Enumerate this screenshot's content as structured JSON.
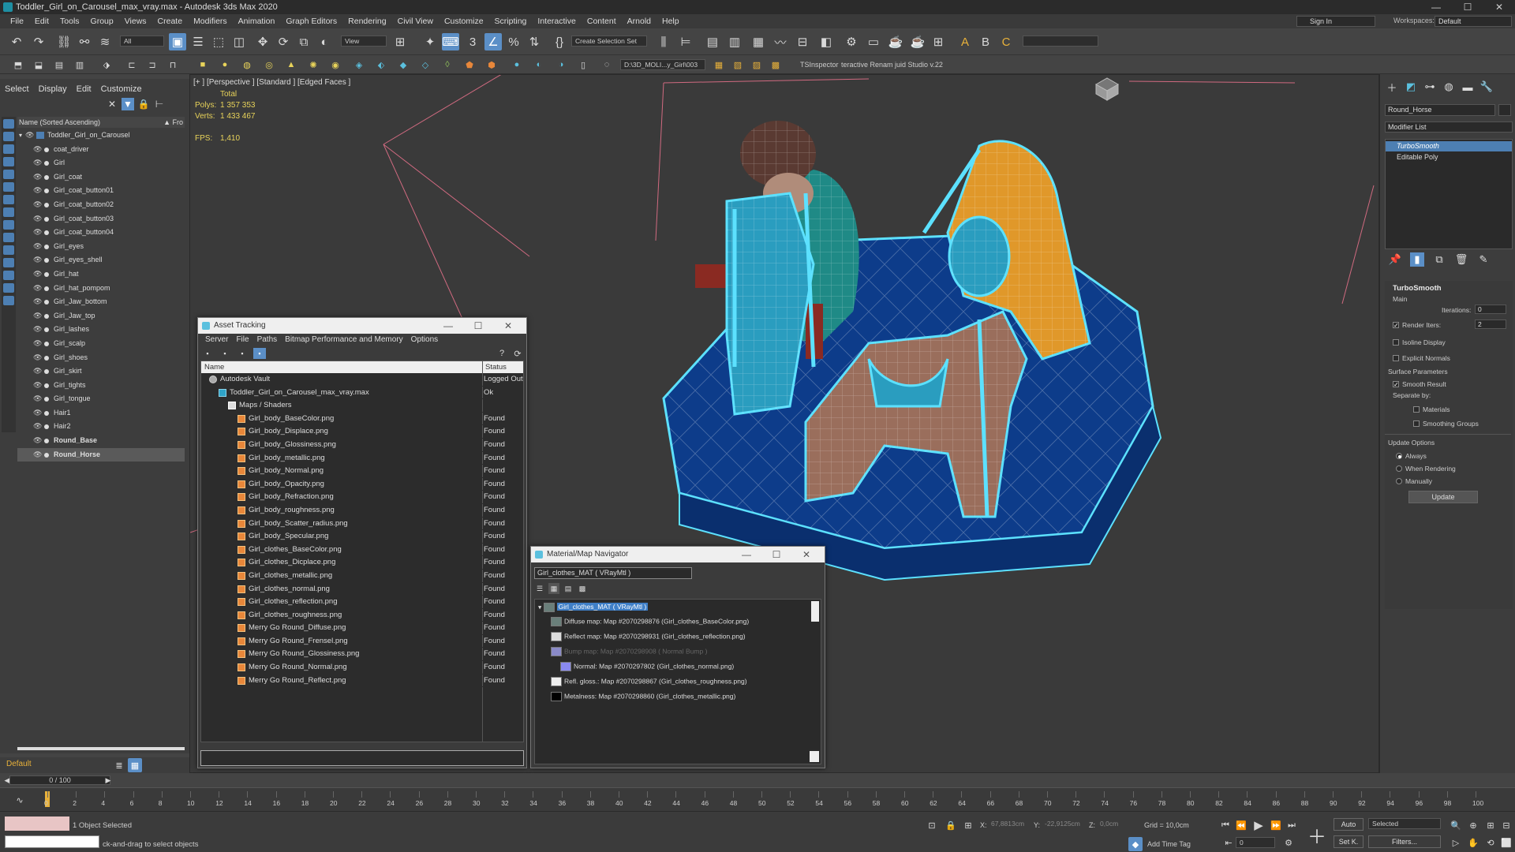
{
  "app": {
    "title": "Toddler_Girl_on_Carousel_max_vray.max - Autodesk 3ds Max 2020",
    "window_controls": [
      "—",
      "☐",
      "✕"
    ]
  },
  "menubar": {
    "items": [
      "File",
      "Edit",
      "Tools",
      "Group",
      "Views",
      "Create",
      "Modifiers",
      "Animation",
      "Graph Editors",
      "Rendering",
      "Civil View",
      "Customize",
      "Scripting",
      "Interactive",
      "Content",
      "Arnold",
      "Help"
    ],
    "sign_in": "Sign In",
    "workspaces_label": "Workspaces:",
    "workspaces_value": "Default"
  },
  "toolbar": {
    "selection_filter": "All",
    "ref_coord": "View",
    "named_selection": "Create Selection Set",
    "path": "D:\\3D_MOLI...y_Girl\\003",
    "ts_inspector": "TSInspector",
    "renamer": "teractive Renam juid Studio v.22"
  },
  "scene_explorer": {
    "tabs": [
      "Select",
      "Display",
      "Edit",
      "Customize"
    ],
    "column_header": "Name (Sorted Ascending)",
    "column_suffix": "▲ Fro",
    "root": "Toddler_Girl_on_Carousel",
    "items": [
      "coat_driver",
      "Girl",
      "Girl_coat",
      "Girl_coat_button01",
      "Girl_coat_button02",
      "Girl_coat_button03",
      "Girl_coat_button04",
      "Girl_eyes",
      "Girl_eyes_shell",
      "Girl_hat",
      "Girl_hat_pompom",
      "Girl_Jaw_bottom",
      "Girl_Jaw_top",
      "Girl_lashes",
      "Girl_scalp",
      "Girl_shoes",
      "Girl_skirt",
      "Girl_tights",
      "Girl_tongue",
      "Hair1",
      "Hair2",
      "Round_Base",
      "Round_Horse"
    ],
    "bold_items": [
      "Round_Base",
      "Round_Horse"
    ],
    "selected_item": "Round_Horse",
    "layer": "Default"
  },
  "viewport": {
    "label": "[+ ] [Perspective ] [Standard ] [Edged Faces ]",
    "stats_header": "Total",
    "polys_label": "Polys:",
    "polys_value": "1 357 353",
    "verts_label": "Verts:",
    "verts_value": "1 433 467",
    "fps_label": "FPS:",
    "fps_value": "1,410"
  },
  "asset_tracking": {
    "title": "Asset Tracking",
    "menu": [
      "Server",
      "File",
      "Paths",
      "Bitmap Performance and Memory",
      "Options"
    ],
    "col_name": "Name",
    "col_status": "Status",
    "rows": [
      {
        "name": "Autodesk Vault",
        "status": "Logged Out",
        "indent": 0,
        "kind": "vault"
      },
      {
        "name": "Toddler_Girl_on_Carousel_max_vray.max",
        "status": "Ok",
        "indent": 1,
        "kind": "file"
      },
      {
        "name": "Maps / Shaders",
        "status": "",
        "indent": 2,
        "kind": "folder"
      },
      {
        "name": "Girl_body_BaseColor.png",
        "status": "Found",
        "indent": 3,
        "kind": "map"
      },
      {
        "name": "Girl_body_Displace.png",
        "status": "Found",
        "indent": 3,
        "kind": "map"
      },
      {
        "name": "Girl_body_Glossiness.png",
        "status": "Found",
        "indent": 3,
        "kind": "map"
      },
      {
        "name": "Girl_body_metallic.png",
        "status": "Found",
        "indent": 3,
        "kind": "map"
      },
      {
        "name": "Girl_body_Normal.png",
        "status": "Found",
        "indent": 3,
        "kind": "map"
      },
      {
        "name": "Girl_body_Opacity.png",
        "status": "Found",
        "indent": 3,
        "kind": "map"
      },
      {
        "name": "Girl_body_Refraction.png",
        "status": "Found",
        "indent": 3,
        "kind": "map"
      },
      {
        "name": "Girl_body_roughness.png",
        "status": "Found",
        "indent": 3,
        "kind": "map"
      },
      {
        "name": "Girl_body_Scatter_radius.png",
        "status": "Found",
        "indent": 3,
        "kind": "map"
      },
      {
        "name": "Girl_body_Specular.png",
        "status": "Found",
        "indent": 3,
        "kind": "map"
      },
      {
        "name": "Girl_clothes_BaseColor.png",
        "status": "Found",
        "indent": 3,
        "kind": "map"
      },
      {
        "name": "Girl_clothes_Dicplace.png",
        "status": "Found",
        "indent": 3,
        "kind": "map"
      },
      {
        "name": "Girl_clothes_metallic.png",
        "status": "Found",
        "indent": 3,
        "kind": "map"
      },
      {
        "name": "Girl_clothes_normal.png",
        "status": "Found",
        "indent": 3,
        "kind": "map"
      },
      {
        "name": "Girl_clothes_reflection.png",
        "status": "Found",
        "indent": 3,
        "kind": "map"
      },
      {
        "name": "Girl_clothes_roughness.png",
        "status": "Found",
        "indent": 3,
        "kind": "map"
      },
      {
        "name": "Merry Go Round_Diffuse.png",
        "status": "Found",
        "indent": 3,
        "kind": "map"
      },
      {
        "name": "Merry Go Round_Frensel.png",
        "status": "Found",
        "indent": 3,
        "kind": "map"
      },
      {
        "name": "Merry Go Round_Glossiness.png",
        "status": "Found",
        "indent": 3,
        "kind": "map"
      },
      {
        "name": "Merry Go Round_Normal.png",
        "status": "Found",
        "indent": 3,
        "kind": "map"
      },
      {
        "name": "Merry Go Round_Reflect.png",
        "status": "Found",
        "indent": 3,
        "kind": "map"
      }
    ]
  },
  "material_navigator": {
    "title": "Material/Map Navigator",
    "field": "Girl_clothes_MAT  ( VRayMtl )",
    "root": "Girl_clothes_MAT  ( VRayMtl )",
    "rows": [
      {
        "text": "Diffuse map: Map #2070298876 (Girl_clothes_BaseColor.png)",
        "dim": false,
        "swatch": "#6a7f7a"
      },
      {
        "text": "Reflect map: Map #2070298931 (Girl_clothes_reflection.png)",
        "dim": false,
        "swatch": "#dddddd"
      },
      {
        "text": "Bump map: Map #2070298908  ( Normal Bump )",
        "dim": true,
        "swatch": "#8a8ac7"
      },
      {
        "text": "Normal: Map #2070297802 (Girl_clothes_normal.png)",
        "dim": false,
        "swatch": "#8a8af0"
      },
      {
        "text": "Refl. gloss.: Map #2070298867 (Girl_clothes_roughness.png)",
        "dim": false,
        "swatch": "#eeeeee"
      },
      {
        "text": "Metalness: Map #2070298860 (Girl_clothes_metallic.png)",
        "dim": false,
        "swatch": "#000000"
      }
    ]
  },
  "command_panel": {
    "object_name": "Round_Horse",
    "modifier_list": "Modifier List",
    "stack": [
      "TurboSmooth",
      "Editable Poly"
    ],
    "turbosmooth_title": "TurboSmooth",
    "main_label": "Main",
    "iterations_label": "Iterations:",
    "iterations_value": "0",
    "render_iters_label": "Render Iters:",
    "render_iters_value": "2",
    "isoline_label": "Isoline Display",
    "explicit_normals_label": "Explicit Normals",
    "surface_params_label": "Surface Parameters",
    "smooth_result_label": "Smooth Result",
    "separate_by_label": "Separate by:",
    "materials_label": "Materials",
    "smoothing_groups_label": "Smoothing Groups",
    "update_options_label": "Update Options",
    "always_label": "Always",
    "when_rendering_label": "When Rendering",
    "manually_label": "Manually",
    "update_button": "Update"
  },
  "timeline": {
    "slider": "0 / 100",
    "ticks": [
      "0",
      "2",
      "4",
      "6",
      "8",
      "10",
      "12",
      "14",
      "16",
      "18",
      "20",
      "22",
      "24",
      "26",
      "28",
      "30",
      "32",
      "34",
      "36",
      "38",
      "40",
      "42",
      "44",
      "46",
      "48",
      "50",
      "52",
      "54",
      "56",
      "58",
      "60",
      "62",
      "64",
      "66",
      "68",
      "70",
      "72",
      "74",
      "76",
      "78",
      "80",
      "82",
      "84",
      "86",
      "88",
      "90",
      "92",
      "94",
      "96",
      "98",
      "100"
    ]
  },
  "status": {
    "selection": "1 Object Selected",
    "prompt": "ck-and-drag to select objects",
    "x_label": "X:",
    "x_value": "67,8813cm",
    "y_label": "Y:",
    "y_value": "-22,9125cm",
    "z_label": "Z:",
    "z_value": "0,0cm",
    "grid": "Grid = 10,0cm",
    "add_time_tag": "Add Time Tag",
    "auto_label": "Auto",
    "setk_label": "Set K.",
    "selected_dd": "Selected",
    "filters_label": "Filters...",
    "frame_value": "0"
  }
}
